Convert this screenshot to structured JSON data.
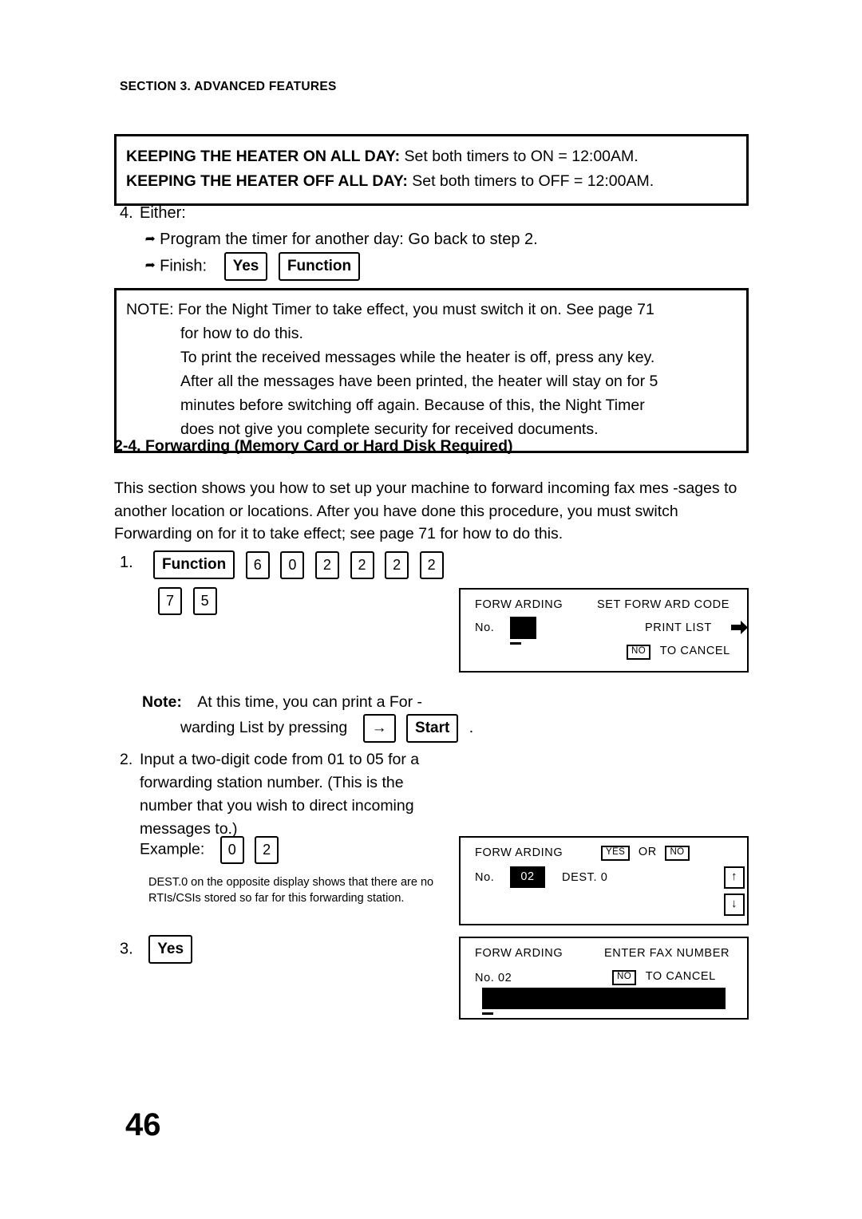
{
  "section_header": "SECTION 3. ADVANCED FEATURES",
  "heater_box": {
    "line1_bold": "KEEPING THE HEATER ON ALL DAY:",
    "line1_rest": " Set both timers to ON = 12:00AM.",
    "line2_bold": "KEEPING THE HEATER OFF ALL DAY:",
    "line2_rest": " Set both timers to OFF = 12:00AM."
  },
  "step4": {
    "number": "4.",
    "label": "Either:",
    "bullet1": "Program the timer for another day: Go back to step 2.",
    "bullet2": "Finish:",
    "key_yes": "Yes",
    "key_function": "Function"
  },
  "note_box": {
    "line1": "NOTE: For the Night Timer to take effect, you must switch it on. See page   71",
    "line2": "for how to do this.",
    "line3": "To print the received messages while the heater is off, press any key.",
    "line4": "After all the messages have been printed, the heater will stay on for 5",
    "line5": "minutes before switching off again. Because of this, the Night Timer",
    "line6": "does not give you complete security for received documents."
  },
  "sub_heading": "2-4. Forwarding (Memory Card or Hard Disk Required)",
  "body_paragraph": "This section shows you how to set up your machine to forward incoming fax mes  -sages to another location or locations. After you have done this procedure, you must switch Forwarding on for it to take effect; see page   71 for how to do this.",
  "step1": {
    "number": "1.",
    "key_function": "Function",
    "keys": [
      "6",
      "0",
      "2",
      "2",
      "2",
      "2"
    ],
    "keys_row2": [
      "7",
      "5"
    ]
  },
  "lcd1": {
    "title": "FORW ARDING",
    "right_title": "SET FORW ARD CODE",
    "no_label": "No.",
    "print_list": "PRINT LIST",
    "no_key": "NO",
    "to_cancel": "TO CANCEL"
  },
  "note2": {
    "label": "Note:",
    "text1": "At this time, you can print a For -",
    "text2": "warding List by pressing",
    "key_arrow": "→",
    "key_start": "Start",
    "period": "."
  },
  "step2": {
    "number": "2.",
    "text": "Input a two-digit code from 01 to 05 for a forwarding station number.  (This is the number that you wish to direct incoming messages to.)",
    "example_label": "Example:",
    "example_keys": [
      "0",
      "2"
    ]
  },
  "dest_note": "DEST.0 on the opposite display shows that there are no RTIs/CSIs stored so far for this forwarding station.",
  "lcd2": {
    "title": "FORW ARDING",
    "yes_key": "YES",
    "or_label": "OR",
    "no_key": "NO",
    "no_label": "No.",
    "code_value": "02",
    "dest_label": "DEST. 0",
    "up_arrow": "↑",
    "down_arrow": "↓"
  },
  "step3": {
    "number": "3.",
    "key_yes": "Yes"
  },
  "lcd3": {
    "title": "FORW ARDING",
    "right_title": "ENTER FAX NUMBER",
    "no_label": "No.  02",
    "no_key": "NO",
    "to_cancel": "TO CANCEL"
  },
  "page_number": "46"
}
